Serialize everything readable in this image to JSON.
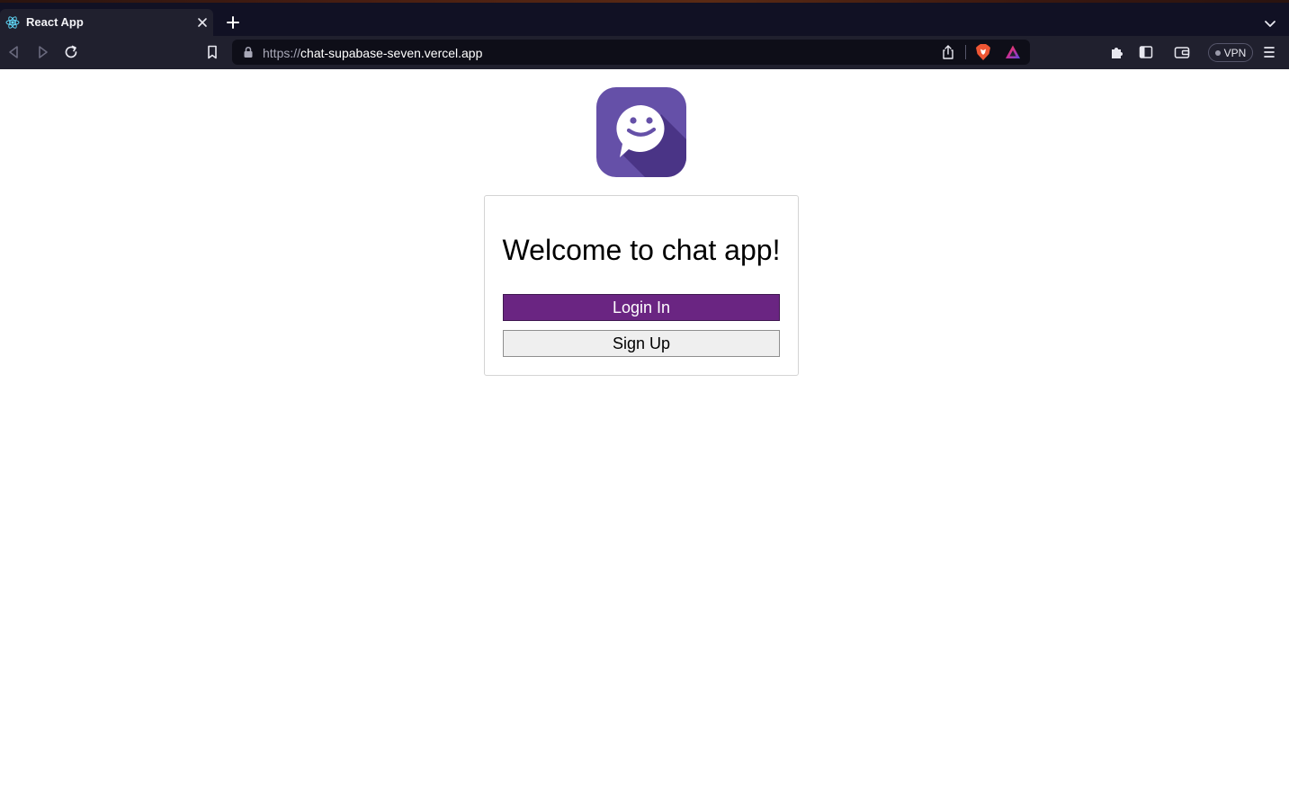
{
  "browser": {
    "tab": {
      "title": "React App",
      "favicon": "react-logo-icon"
    },
    "url": {
      "scheme": "https://",
      "host": "chat-supabase-seven.vercel.app"
    },
    "vpn_label": "VPN",
    "icons": {
      "back": "back-icon",
      "forward": "forward-icon",
      "reload": "reload-icon",
      "bookmark": "bookmark-icon",
      "lock": "lock-icon",
      "share": "share-icon",
      "brave_shields": "brave-shields-icon",
      "rewards": "brave-rewards-icon",
      "extensions": "puzzle-icon",
      "sidebar": "sidebar-icon",
      "wallet": "wallet-icon",
      "menu": "hamburger-menu-icon",
      "new_tab": "plus-icon",
      "tab_close": "close-icon",
      "tab_list": "chevron-down-icon"
    }
  },
  "app": {
    "logo": "chat-bubble-smile-icon",
    "welcome_heading": "Welcome to chat app!",
    "login_button": "Login In",
    "signup_button": "Sign Up",
    "colors": {
      "primary": "#6a2582",
      "logo_bg": "#6550a8",
      "logo_shadow": "#4a3486"
    }
  }
}
